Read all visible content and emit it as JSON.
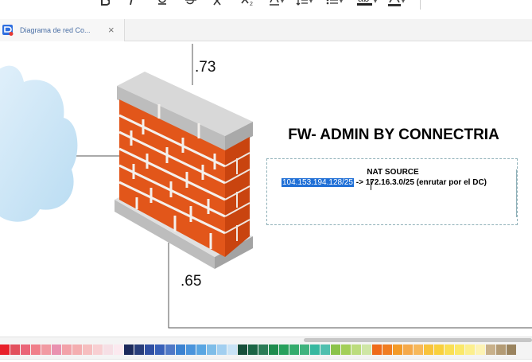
{
  "toolbar": {
    "buttons": [
      {
        "icon": "bold-icon"
      },
      {
        "icon": "italic-icon"
      },
      {
        "icon": "underline-icon"
      },
      {
        "icon": "strikethrough-icon"
      },
      {
        "icon": "superscript-icon"
      },
      {
        "icon": "subscript-icon"
      },
      {
        "icon": "text-color-a-icon"
      },
      {
        "icon": "line-spacing-icon"
      },
      {
        "icon": "bullet-list-icon"
      },
      {
        "icon": "highlight-ab-icon",
        "label": "ab"
      },
      {
        "icon": "font-color-a-icon"
      }
    ]
  },
  "tabs": [
    {
      "label": "Diagrama de red Co...",
      "close": "×",
      "icon": "edraw-doc-icon"
    }
  ],
  "diagram": {
    "label_top": ".73",
    "label_bottom": ".65",
    "firewall_title": "FW- ADMIN BY CONNECTRIA",
    "nat_title": "NAT SOURCE",
    "nat_selected": "104.153.194.128/25",
    "nat_rest": " -> 172.16.3.0/25 (enrutar por el DC)",
    "icons": [
      "cloud-icon",
      "firewall-icon"
    ]
  },
  "palette": {
    "colors": [
      "#e8202a",
      "#e2505d",
      "#ea6578",
      "#f07f8a",
      "#f19aa2",
      "#e992b0",
      "#f2a2a9",
      "#f4aeb0",
      "#f6bebf",
      "#f8cfd2",
      "#f6dfe5",
      "#fbe9ef",
      "#1c2a5c",
      "#283d7a",
      "#2f4fa2",
      "#3860b8",
      "#4f78c6",
      "#3b82d1",
      "#4a94dc",
      "#5aa6e2",
      "#7fbde8",
      "#a2cff0",
      "#c9e3f6",
      "#174f3a",
      "#1b6545",
      "#2b7c56",
      "#1f8c4e",
      "#27a05c",
      "#34ab6c",
      "#3fb37e",
      "#37b8a0",
      "#4fbfae",
      "#8bc34a",
      "#a3cf59",
      "#bcdc7e",
      "#cfe6a6",
      "#ef6b1a",
      "#f07d22",
      "#f39a28",
      "#f5a94a",
      "#f7b85a",
      "#f8c33c",
      "#f9d03d",
      "#fadf55",
      "#fbe86a",
      "#fcef8e",
      "#fdf3b4",
      "#c8b08a",
      "#b39b75",
      "#9a845f"
    ]
  }
}
